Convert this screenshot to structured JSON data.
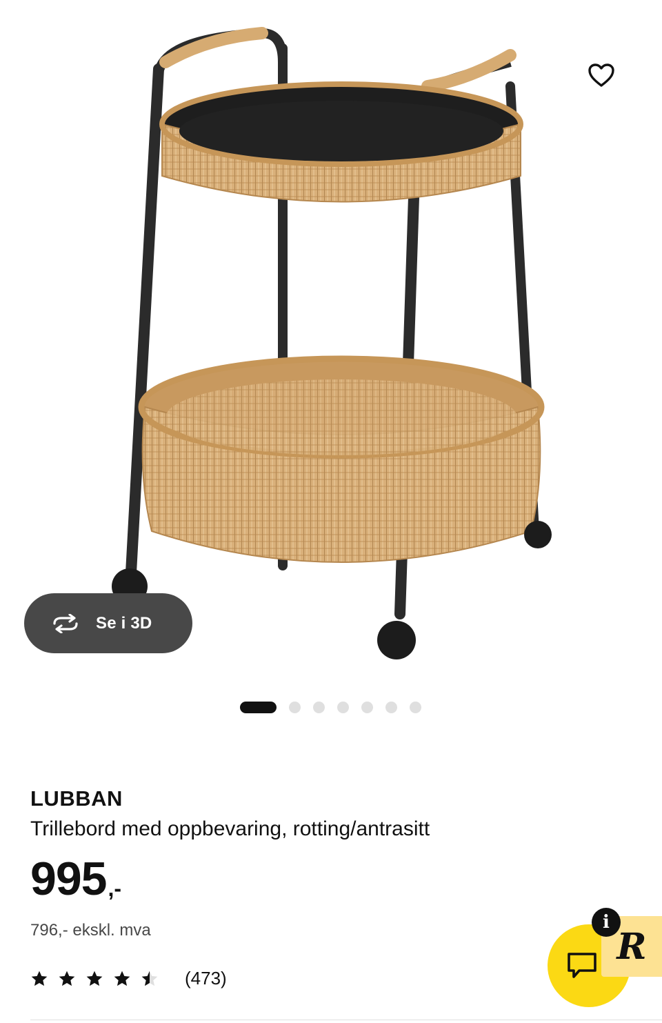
{
  "gallery": {
    "view3d_label": "Se i 3D",
    "icons": {
      "favourite": "heart-outline-icon",
      "view3d": "rotate-3d-icon"
    },
    "dots_total": 7,
    "active_dot": 1
  },
  "product": {
    "brand": "LUBBAN",
    "description": "Trillebord med oppbevaring, rotting/antrasitt",
    "price_main": "995",
    "price_suffix": ",-",
    "price_ex_vat": "796,- ekskl. mva",
    "rating": 4.5,
    "rating_max": 5,
    "review_count": "(473)"
  },
  "overlays": {
    "chat_icon": "chat-icon",
    "rakuten_letter": "R",
    "info_letter": "i"
  },
  "colors": {
    "chat_yellow": "#fbd914",
    "badge_yellow": "#fde293",
    "button_grey": "#484848",
    "rattan": "#d6ab72",
    "metal": "#2b2b2b"
  }
}
